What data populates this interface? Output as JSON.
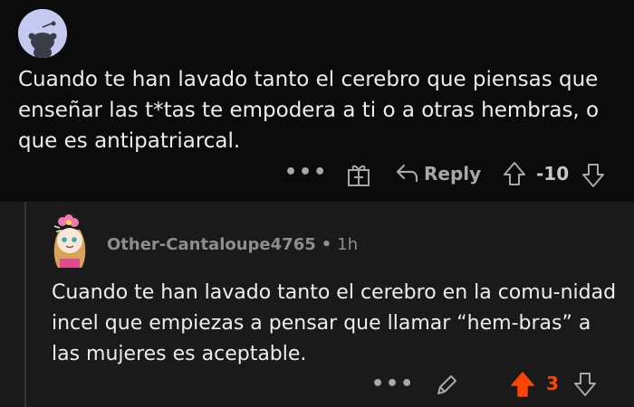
{
  "parent_comment": {
    "text": "Cuando te han lavado tanto el cerebro que piensas que enseñar las t*tas te empodera a ti o a otras hembras, o que es antipatriarcal.",
    "more_label": "•••",
    "reply_label": "Reply",
    "score": "-10"
  },
  "reply_comment": {
    "username": "Other-Cantaloupe4765",
    "separator": "•",
    "time": "1h",
    "text": "Cuando te han lavado tanto el cerebro en la comu-nidad incel que empiezas a pensar que llamar “hem-bras” a las mujeres es aceptable.",
    "more_label": "•••",
    "score": "3"
  },
  "colors": {
    "background_top": "#0b0b0b",
    "background_reply": "#1a1a1b",
    "upvote_active": "#ff4500",
    "muted_text": "#a8a8a8"
  },
  "icons": [
    "default-avatar-icon",
    "more-icon",
    "gift-award-icon",
    "reply-icon",
    "upvote-icon",
    "downvote-icon",
    "edit-icon",
    "user-avatar-icon"
  ]
}
